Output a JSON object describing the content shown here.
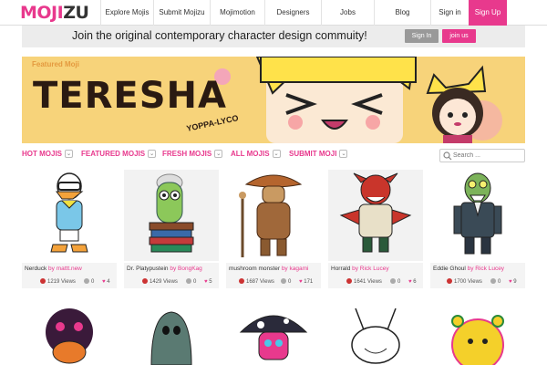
{
  "nav": {
    "logo_a": "MOJI",
    "logo_b": "ZU",
    "items": [
      "Explore Mojis",
      "Submit Mojizu",
      "Mojimotion",
      "Designers",
      "Jobs",
      "Blog",
      "Sign in"
    ],
    "signup": "Sign Up"
  },
  "join": {
    "text": "Join the original contemporary character design commuity!",
    "signin": "Sign In",
    "join": "join us"
  },
  "featured": {
    "label": "Featured Moji",
    "title": "TERESHA",
    "signature": "YOPPA-LYCO"
  },
  "categories": [
    "HOT MOJIS",
    "FEATURED MOJIS",
    "FRESH MOJIS",
    "ALL MOJIS",
    "SUBMIT MOJI"
  ],
  "search": {
    "placeholder": "Search ..."
  },
  "colors": {
    "accent": "#e8398d",
    "banner": "#f7d37a"
  },
  "cards": [
    {
      "name": "Nerduck",
      "by": "by mattt.new",
      "views": "1219 Views",
      "comments": "0",
      "likes": "4"
    },
    {
      "name": "Dr. Platypustein",
      "by": "by BongKag",
      "views": "1429 Views",
      "comments": "0",
      "likes": "5"
    },
    {
      "name": "mushroom monster",
      "by": "by kagami",
      "views": "1687 Views",
      "comments": "0",
      "likes": "171"
    },
    {
      "name": "Horrald",
      "by": "by Rick Lucey",
      "views": "1641 Views",
      "comments": "0",
      "likes": "6"
    },
    {
      "name": "Eddie Ghoul",
      "by": "by Rick Lucey",
      "views": "1700 Views",
      "comments": "0",
      "likes": "9"
    }
  ]
}
